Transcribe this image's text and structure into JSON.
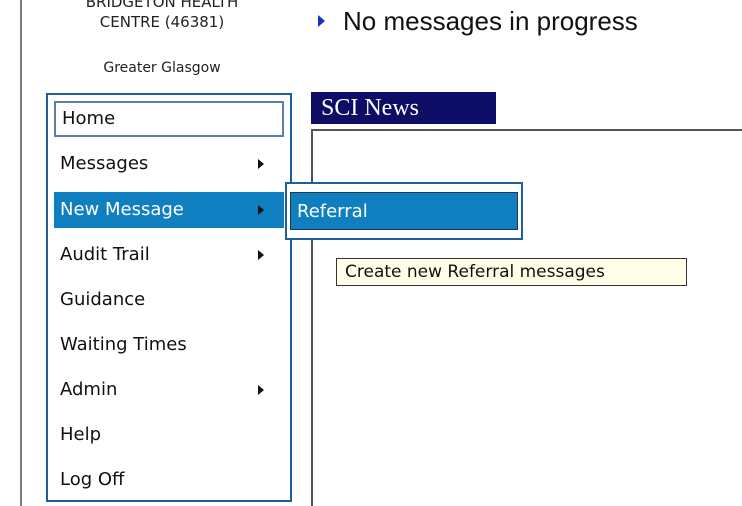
{
  "header": {
    "practice_line1": "BRIDGETON HEALTH",
    "practice_line2": "CENTRE (46381)",
    "health_board": "Greater Glasgow",
    "status_message": "No messages in progress"
  },
  "menu": {
    "items": [
      {
        "label": "Home",
        "has_submenu": false
      },
      {
        "label": "Messages",
        "has_submenu": true
      },
      {
        "label": "New Message",
        "has_submenu": true,
        "active": true
      },
      {
        "label": "Audit Trail",
        "has_submenu": true
      },
      {
        "label": "Guidance",
        "has_submenu": false
      },
      {
        "label": "Waiting Times",
        "has_submenu": false
      },
      {
        "label": "Admin",
        "has_submenu": true
      },
      {
        "label": "Help",
        "has_submenu": false
      },
      {
        "label": "Log Off",
        "has_submenu": false
      }
    ]
  },
  "submenu": {
    "items": [
      {
        "label": "Referral"
      }
    ]
  },
  "news": {
    "title": "SCI News"
  },
  "tooltip": {
    "text": "Create new Referral messages"
  },
  "colors": {
    "menu_highlight": "#0f7fc0",
    "news_tab_bg": "#0d0d66",
    "status_arrow": "#1030c8",
    "menu_border": "#1f5f99"
  }
}
